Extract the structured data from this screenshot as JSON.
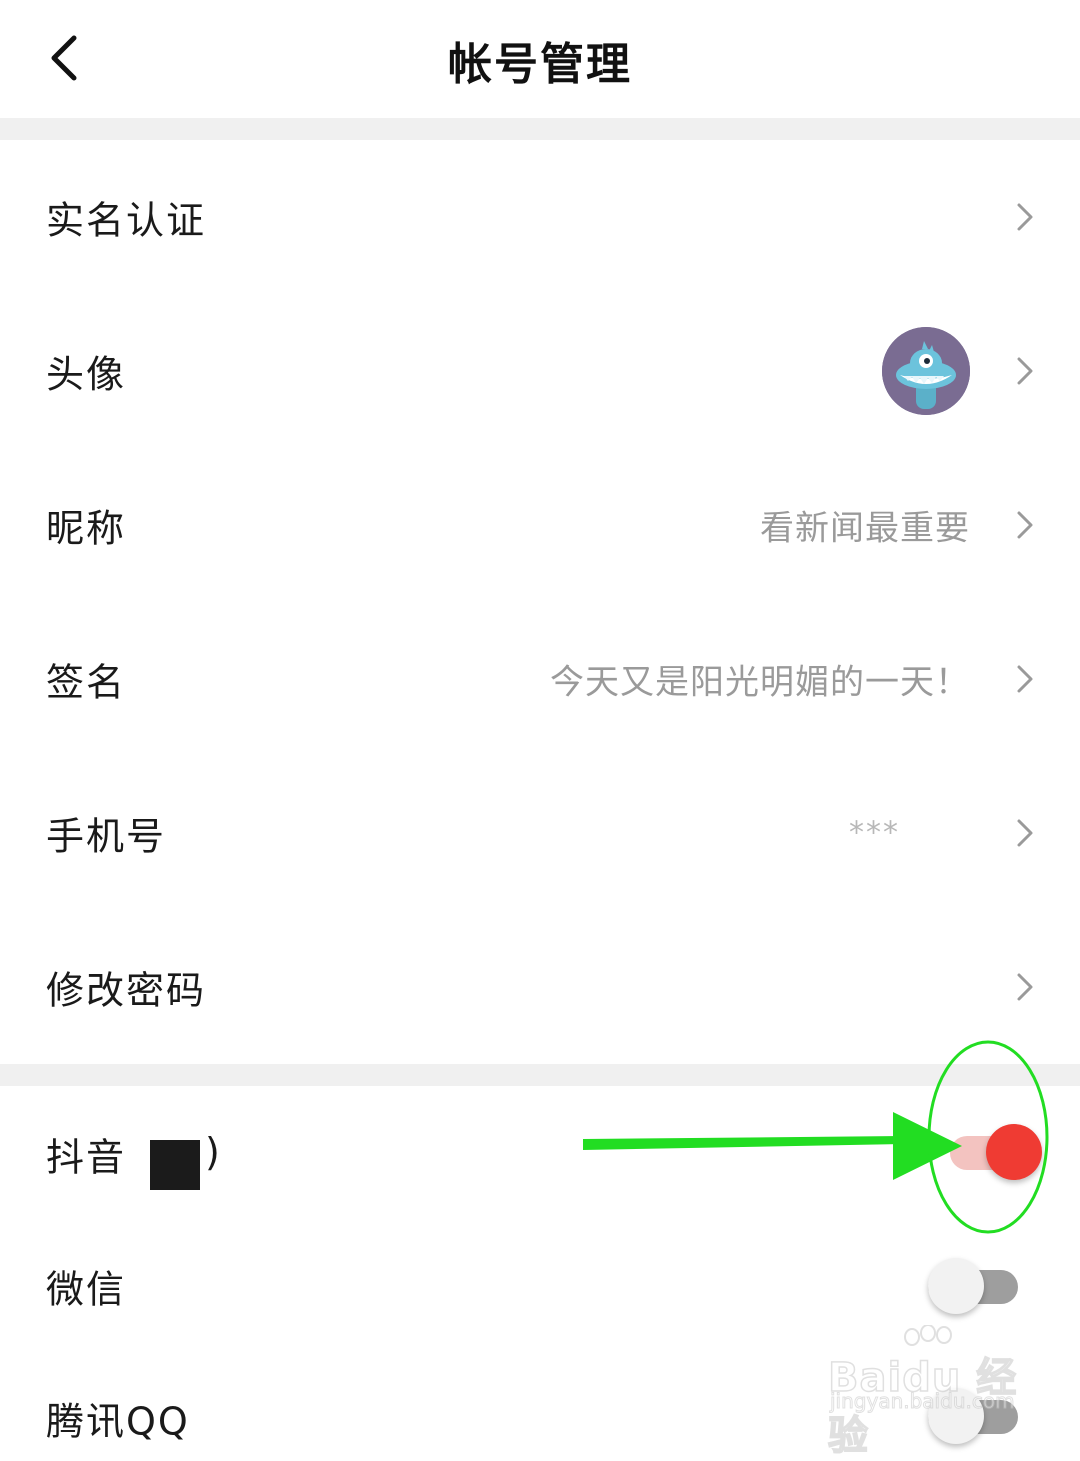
{
  "header": {
    "title": "帐号管理",
    "back_icon": "chevron-left-icon"
  },
  "profile": {
    "rows": [
      {
        "label": "实名认证",
        "value": ""
      },
      {
        "label": "头像",
        "value": ""
      },
      {
        "label": "昵称",
        "value": "看新闻最重要"
      },
      {
        "label": "签名",
        "value": "今天又是阳光明媚的一天！"
      },
      {
        "label": "手机号",
        "value": "***"
      },
      {
        "label": "修改密码",
        "value": ""
      }
    ]
  },
  "bindings": {
    "items": [
      {
        "label": "抖音",
        "paren_close": ")",
        "enabled": true
      },
      {
        "label": "微信",
        "enabled": false
      },
      {
        "label": "腾讯QQ",
        "enabled": false
      }
    ]
  },
  "colors": {
    "toggle_on_knob": "#ef3b33",
    "toggle_on_track": "#f3c3c0",
    "toggle_off_track": "#9e9e9e",
    "annotation_green": "#22dd22",
    "section_gap": "#f0f0f0"
  },
  "watermark": {
    "brand": "Baidu 经验",
    "url": "jingyan.baidu.com"
  }
}
